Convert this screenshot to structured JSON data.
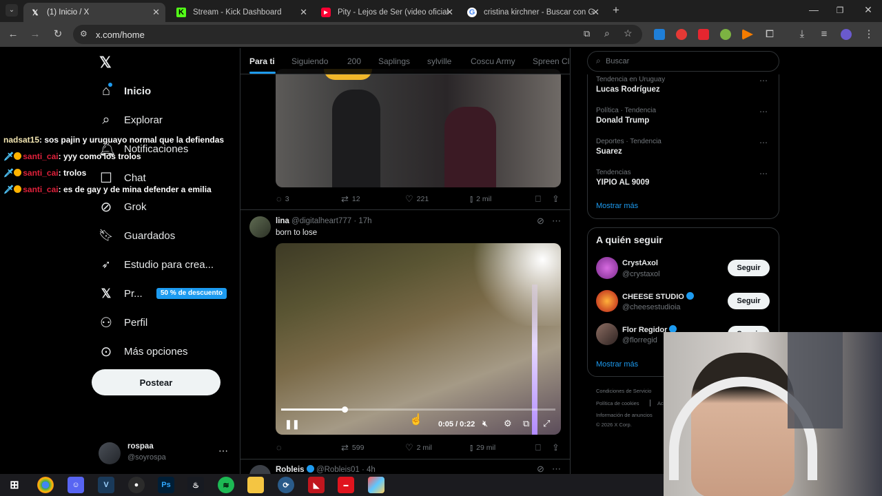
{
  "browser": {
    "tabs": [
      {
        "title": "(1) Inicio / X",
        "icon": "x-logo-icon",
        "active": true
      },
      {
        "title": "Stream - Kick Dashboard",
        "icon": "kick-icon",
        "active": false
      },
      {
        "title": "Pity - Lejos de Ser (video oficial",
        "icon": "youtube-icon",
        "active": false
      },
      {
        "title": "cristina kirchner - Buscar con G",
        "icon": "google-icon",
        "active": false
      }
    ],
    "new_tab": "+",
    "url": "x.com/home"
  },
  "nav": {
    "items": [
      {
        "label": "Inicio",
        "icon": "home-icon"
      },
      {
        "label": "Explorar",
        "icon": "search-icon"
      },
      {
        "label": "Notificaciones",
        "icon": "bell-icon"
      },
      {
        "label": "Chat",
        "icon": "chat-icon"
      },
      {
        "label": "Grok",
        "icon": "grok-icon"
      },
      {
        "label": "Guardados",
        "icon": "bookmark-icon"
      },
      {
        "label": "Estudio para crea...",
        "icon": "rocket-icon"
      },
      {
        "label": "Pr...",
        "icon": "x-premium-icon"
      },
      {
        "label": "Perfil",
        "icon": "person-icon"
      },
      {
        "label": "Más opciones",
        "icon": "more-circle-icon"
      }
    ],
    "premium_badge": "50 % de descuento",
    "post_button": "Postear",
    "account": {
      "name": "rospaa",
      "handle": "@soyrospa"
    }
  },
  "timeline": {
    "tabs": [
      "Para ti",
      "Siguiendo",
      "200",
      "Saplings",
      "sylville",
      "Coscu Army",
      "Spreen Cl"
    ],
    "post1_actions": {
      "replies": "3",
      "reposts": "12",
      "likes": "221",
      "views": "2 mil"
    },
    "post2": {
      "author": "lina",
      "handle": "@digitalheart777",
      "time": "· 17h",
      "text": "born to lose",
      "video_time": "0:05 / 0:22",
      "progress": 0.23,
      "actions": {
        "replies": "",
        "reposts": "599",
        "likes": "2 mil",
        "views": "29 mil"
      }
    },
    "post3": {
      "author": "Robleis",
      "handle": "@Robleis01",
      "time": "· 4h"
    }
  },
  "sidebar": {
    "search_placeholder": "Buscar",
    "trends": [
      {
        "meta": "Tendencia en Uruguay",
        "name": "Lucas Rodríguez"
      },
      {
        "meta": "Política · Tendencia",
        "name": "Donald Trump"
      },
      {
        "meta": "Deportes · Tendencia",
        "name": "Suarez"
      },
      {
        "meta": "Tendencias",
        "name": "YIPIO AL 9009"
      }
    ],
    "show_more": "Mostrar más",
    "who_to_follow_title": "A quién seguir",
    "follow": [
      {
        "name": "CrystAxol",
        "handle": "@crystaxol",
        "verified": false,
        "button": "Seguir"
      },
      {
        "name": "CHEESE STUDIO",
        "handle": "@cheesestudioia",
        "verified": true,
        "button": "Seguir"
      },
      {
        "name": "Flor Regidor",
        "handle": "@florregid",
        "verified": true,
        "button": "Seguir"
      }
    ],
    "show_more2": "Mostrar más",
    "footer": [
      "Condiciones de Servicio",
      "Política de cookies",
      "Ac",
      "Información de anuncios",
      "© 2026 X Corp."
    ]
  },
  "stream_chat": [
    {
      "user": "nadsat15",
      "text": "sos pajin y uruguayo normal que la defiendas",
      "color": "#ffffff",
      "badges": false
    },
    {
      "user": "santi_cai",
      "text": "yyy como los trolos",
      "color": "#e0213b",
      "badges": true
    },
    {
      "user": "santi_cai",
      "text": "trolos",
      "color": "#e0213b",
      "badges": true
    },
    {
      "user": "santi_cai",
      "text": "es de gay y de mina defender a emilia",
      "color": "#e0213b",
      "badges": true
    }
  ],
  "colors": {
    "accent": "#1d9bf0",
    "background": "#000000",
    "border": "#2f3336",
    "secondary_text": "#71767b"
  }
}
